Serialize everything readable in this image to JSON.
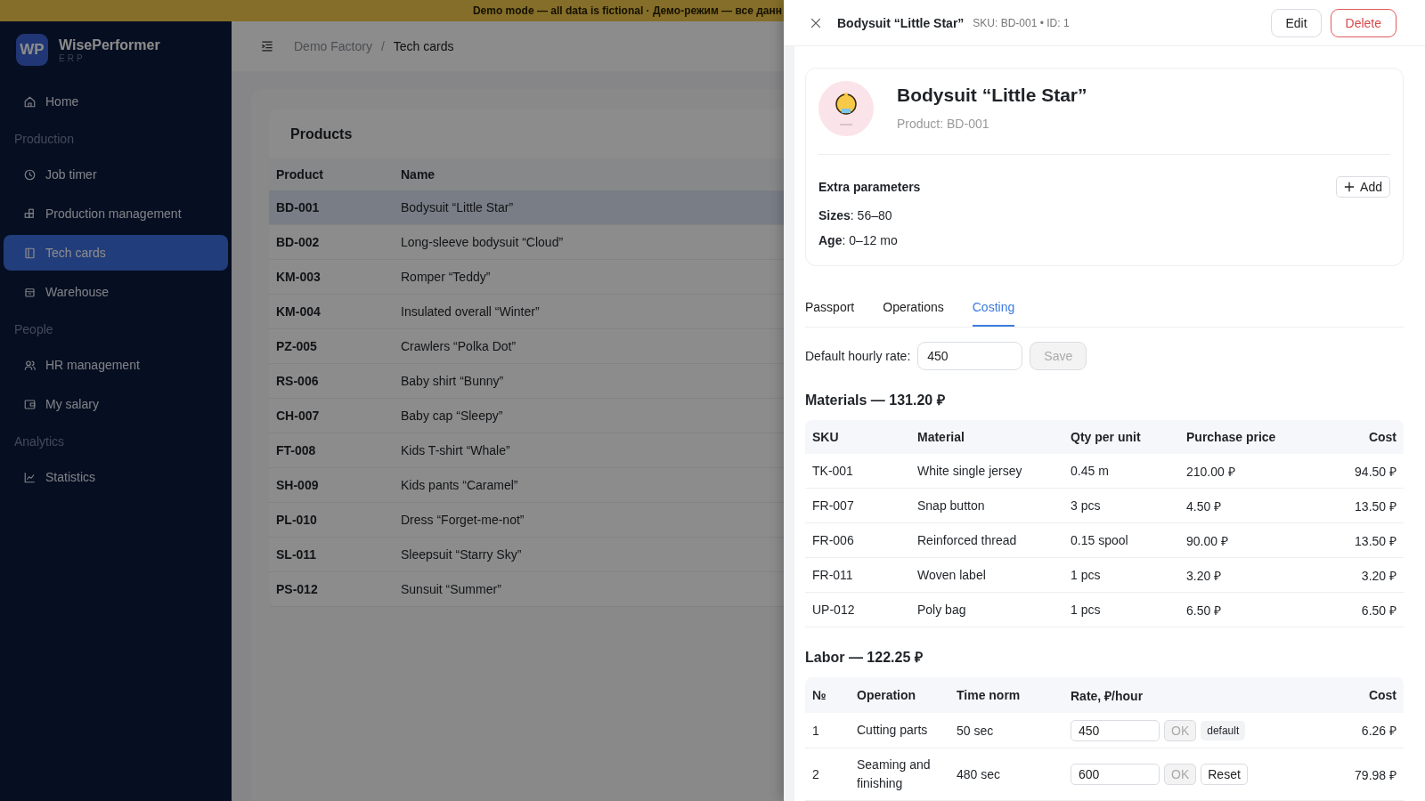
{
  "banner": {
    "text": "Demo mode — all data is fictional · Демо-режим — все данн"
  },
  "sidebar": {
    "logo": {
      "mark": "WP",
      "name": "WisePerformer",
      "sub": "ERP"
    },
    "items": [
      {
        "kind": "item",
        "label": "Home",
        "selected": false
      },
      {
        "kind": "section",
        "label": "Production"
      },
      {
        "kind": "item",
        "label": "Job timer",
        "selected": false
      },
      {
        "kind": "item",
        "label": "Production management",
        "selected": false
      },
      {
        "kind": "item",
        "label": "Tech cards",
        "selected": true
      },
      {
        "kind": "item",
        "label": "Warehouse",
        "selected": false
      },
      {
        "kind": "section",
        "label": "People"
      },
      {
        "kind": "item",
        "label": "HR management",
        "selected": false
      },
      {
        "kind": "item",
        "label": "My salary",
        "selected": false
      },
      {
        "kind": "section",
        "label": "Analytics"
      },
      {
        "kind": "item",
        "label": "Statistics",
        "selected": false
      }
    ]
  },
  "breadcrumb": {
    "items": [
      "Demo Factory",
      "Tech cards"
    ],
    "separator": "/"
  },
  "products": {
    "title": "Products",
    "columns": [
      "Product",
      "Name"
    ],
    "rows": [
      {
        "code": "BD-001",
        "name": "Bodysuit “Little Star”",
        "selected": true
      },
      {
        "code": "BD-002",
        "name": "Long-sleeve bodysuit “Cloud”",
        "selected": false
      },
      {
        "code": "KM-003",
        "name": "Romper “Teddy”",
        "selected": false
      },
      {
        "code": "KM-004",
        "name": "Insulated overall “Winter”",
        "selected": false
      },
      {
        "code": "PZ-005",
        "name": "Crawlers “Polka Dot”",
        "selected": false
      },
      {
        "code": "RS-006",
        "name": "Baby shirt “Bunny”",
        "selected": false
      },
      {
        "code": "CH-007",
        "name": "Baby cap “Sleepy”",
        "selected": false
      },
      {
        "code": "FT-008",
        "name": "Kids T-shirt “Whale”",
        "selected": false
      },
      {
        "code": "SH-009",
        "name": "Kids pants “Caramel”",
        "selected": false
      },
      {
        "code": "PL-010",
        "name": "Dress “Forget-me-not”",
        "selected": false
      },
      {
        "code": "SL-011",
        "name": "Sleepsuit “Starry Sky”",
        "selected": false
      },
      {
        "code": "PS-012",
        "name": "Sunsuit “Summer”",
        "selected": false
      }
    ]
  },
  "drawer": {
    "title": "Bodysuit “Little Star”",
    "meta": "SKU: BD-001 • ID: 1",
    "actions": [
      {
        "label": "Edit",
        "kind": "default"
      },
      {
        "label": "Delete",
        "kind": "danger"
      }
    ],
    "card": {
      "image": {
        "kind": "picture"
      },
      "name": "Bodysuit “Little Star”",
      "subtitle": "Product: BD-001",
      "params_title": "Extra parameters",
      "add_label": "Add",
      "params": [
        "**Sizes**: 56–80",
        "**Age**: 0–12 mo"
      ]
    },
    "tabs": [
      {
        "label": "Passport",
        "selected": false
      },
      {
        "label": "Operations",
        "selected": false
      },
      {
        "label": "Costing",
        "selected": true
      }
    ],
    "rate": {
      "label": "Default hourly rate:",
      "value": "450",
      "save": "Save",
      "save_disabled": true
    },
    "materials": {
      "title": "Materials — 131.20 ₽",
      "columns": [
        "SKU",
        "Material",
        "Qty per unit",
        "Purchase price",
        "Cost"
      ],
      "rows": [
        [
          "TK-001",
          "White single jersey",
          "0.45 m",
          "210.00 ₽",
          "94.50 ₽"
        ],
        [
          "FR-007",
          "Snap button",
          "3 pcs",
          "4.50 ₽",
          "13.50 ₽"
        ],
        [
          "FR-006",
          "Reinforced thread",
          "0.15 spool",
          "90.00 ₽",
          "13.50 ₽"
        ],
        [
          "FR-011",
          "Woven label",
          "1 pcs",
          "3.20 ₽",
          "3.20 ₽"
        ],
        [
          "UP-012",
          "Poly bag",
          "1 pcs",
          "6.50 ₽",
          "6.50 ₽"
        ]
      ]
    },
    "labor": {
      "title": "Labor — 122.25 ₽",
      "columns": [
        "№",
        "Operation",
        "Time norm",
        "Rate, ₽/hour",
        "Cost"
      ],
      "rows": [
        {
          "no": "1",
          "operation": "Cutting parts",
          "time": "50 sec",
          "rate": "450",
          "ok": "OK",
          "ok_disabled": true,
          "action": {
            "label": "default",
            "kind": "tag"
          },
          "cost": "6.26 ₽"
        },
        {
          "no": "2",
          "operation": "Seaming and finishing",
          "time": "480 sec",
          "rate": "600",
          "ok": "OK",
          "ok_disabled": true,
          "action": {
            "label": "Reset",
            "kind": "button"
          },
          "cost": "79.98 ₽"
        }
      ]
    }
  }
}
